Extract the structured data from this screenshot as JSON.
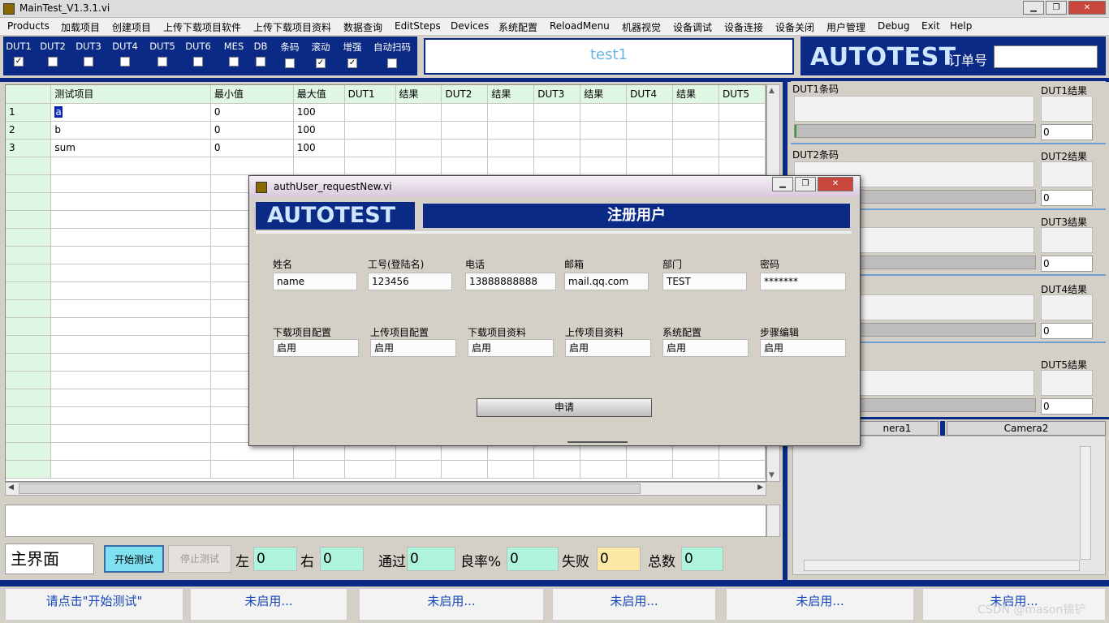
{
  "window": {
    "title": "MainTest_V1.3.1.vi"
  },
  "menu": [
    "Products",
    "加载项目",
    "创建项目",
    "上传下载项目软件",
    "上传下载项目资料",
    "数据查询",
    "EditSteps",
    "Devices",
    "系统配置",
    "ReloadMenu",
    "机器视觉",
    "设备调试",
    "设备连接",
    "设备关闭",
    "用户管理",
    "Debug",
    "Exit",
    "Help"
  ],
  "duts": [
    {
      "label": "DUT1",
      "checked": true
    },
    {
      "label": "DUT2",
      "checked": false
    },
    {
      "label": "DUT3",
      "checked": false
    },
    {
      "label": "DUT4",
      "checked": false
    },
    {
      "label": "DUT5",
      "checked": false
    },
    {
      "label": "DUT6",
      "checked": false
    },
    {
      "label": "MES",
      "checked": false
    },
    {
      "label": "DB",
      "checked": false
    },
    {
      "label": "条码",
      "checked": false
    },
    {
      "label": "滚动",
      "checked": true
    },
    {
      "label": "增强",
      "checked": true
    },
    {
      "label": "自动扫码",
      "checked": false
    }
  ],
  "test_name": "test1",
  "brand": "AUTOTEST",
  "order": {
    "label": "订单号",
    "value": ""
  },
  "grid": {
    "headers": [
      "",
      "测试项目",
      "最小值",
      "最大值",
      "DUT1",
      "结果",
      "DUT2",
      "结果",
      "DUT3",
      "结果",
      "DUT4",
      "结果",
      "DUT5"
    ],
    "rows": [
      [
        "1",
        "a",
        "0",
        "100"
      ],
      [
        "2",
        "b",
        "0",
        "100"
      ],
      [
        "3",
        "sum",
        "0",
        "100"
      ]
    ]
  },
  "right_panels": [
    {
      "label": "DUT1条码",
      "result_label": "DUT1结果",
      "value": "0"
    },
    {
      "label": "DUT2条码",
      "result_label": "DUT2结果",
      "value": "0"
    },
    {
      "label": "",
      "result_label": "DUT3结果",
      "value": "0"
    },
    {
      "label": "",
      "result_label": "DUT4结果",
      "value": "0"
    },
    {
      "label": "",
      "result_label": "DUT5结果",
      "value": "0"
    }
  ],
  "camera_tabs": [
    "nera1",
    "Camera2"
  ],
  "controls": {
    "main_label": "主界面",
    "start": "开始测试",
    "stop": "停止测试",
    "left_label": "左",
    "left_value": "0",
    "right_label": "右",
    "right_value": "0",
    "pass_label": "通过",
    "pass_value": "0",
    "yield_label": "良率%",
    "yield_value": "0",
    "fail_label": "失败",
    "fail_value": "0",
    "total_label": "总数",
    "total_value": "0"
  },
  "status": [
    "请点击\"开始测试\"",
    "未启用...",
    "未启用...",
    "未启用...",
    "未启用...",
    "未启用..."
  ],
  "watermark": "CSDN @mason镐铲",
  "dialog": {
    "title": "authUser_requestNew.vi",
    "brand": "AUTOTEST",
    "heading": "注册用户",
    "fields": [
      {
        "label": "姓名",
        "value": "name"
      },
      {
        "label": "工号(登陆名)",
        "value": "123456"
      },
      {
        "label": "电话",
        "value": "13888888888"
      },
      {
        "label": "邮箱",
        "value": "mail.qq.com"
      },
      {
        "label": "部门",
        "value": "TEST"
      },
      {
        "label": "密码",
        "value": "*******"
      }
    ],
    "permissions": [
      {
        "label": "下载项目配置",
        "value": "启用"
      },
      {
        "label": "上传项目配置",
        "value": "启用"
      },
      {
        "label": "下载项目资料",
        "value": "启用"
      },
      {
        "label": "上传项目资料",
        "value": "启用"
      },
      {
        "label": "系统配置",
        "value": "启用"
      },
      {
        "label": "步骤编辑",
        "value": "启用"
      }
    ],
    "apply": "申请"
  }
}
